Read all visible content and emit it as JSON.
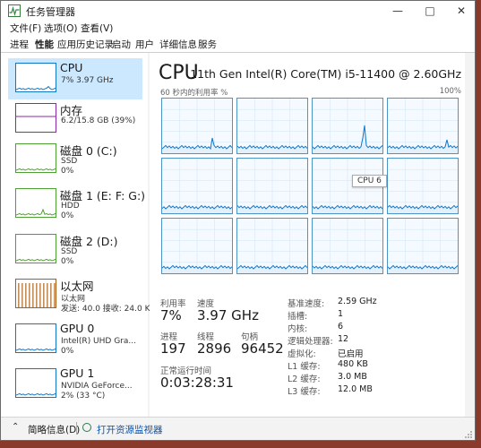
{
  "window": {
    "title": "任务管理器"
  },
  "menu": [
    "文件(F)",
    "选项(O)",
    "查看(V)"
  ],
  "tabs": [
    "进程",
    "性能",
    "应用历史记录",
    "启动",
    "用户",
    "详细信息",
    "服务"
  ],
  "active_tab": "性能",
  "sidebar": {
    "items": [
      {
        "name": "CPU",
        "sub1": "7%  3.97 GHz",
        "sub2": "",
        "color": "#1176c8"
      },
      {
        "name": "内存",
        "sub1": "6.2/15.8 GB (39%)",
        "sub2": "",
        "color": "#8b28a8"
      },
      {
        "name": "磁盘 0 (C:)",
        "sub1": "SSD",
        "sub2": "0%",
        "color": "#4da032"
      },
      {
        "name": "磁盘 1 (E: F: G:)",
        "sub1": "HDD",
        "sub2": "0%",
        "color": "#4da032"
      },
      {
        "name": "磁盘 2 (D:)",
        "sub1": "SSD",
        "sub2": "0%",
        "color": "#4da032"
      },
      {
        "name": "以太网",
        "sub1": "以太网",
        "sub2": "发送: 40.0  接收: 24.0 K",
        "color": "#a75d14"
      },
      {
        "name": "GPU 0",
        "sub1": "Intel(R) UHD Gra...",
        "sub2": "0%",
        "color": "#1176c8"
      },
      {
        "name": "GPU 1",
        "sub1": "NVIDIA GeForce...",
        "sub2": "2% (33 °C)",
        "color": "#1176c8"
      }
    ]
  },
  "main": {
    "title": "CPU",
    "model": "11th Gen Intel(R) Core(TM) i5-11400 @ 2.60GHz",
    "graph_caption": "60 秒内的利用率 %",
    "graph_max": "100%",
    "tooltip": "CPU 6",
    "stats": {
      "util_label": "利用率",
      "util_value": "7%",
      "speed_label": "速度",
      "speed_value": "3.97 GHz",
      "proc_label": "进程",
      "proc_value": "197",
      "thread_label": "线程",
      "thread_value": "2896",
      "handle_label": "句柄",
      "handle_value": "96452",
      "uptime_label": "正常运行时间",
      "uptime_value": "0:03:28:31"
    },
    "specs": [
      {
        "label": "基准速度:",
        "value": "2.59 GHz"
      },
      {
        "label": "插槽:",
        "value": "1"
      },
      {
        "label": "内核:",
        "value": "6"
      },
      {
        "label": "逻辑处理器:",
        "value": "12"
      },
      {
        "label": "虚拟化:",
        "value": "已启用"
      },
      {
        "label": "L1 缓存:",
        "value": "480 KB"
      },
      {
        "label": "L2 缓存:",
        "value": "3.0 MB"
      },
      {
        "label": "L3 缓存:",
        "value": "12.0 MB"
      }
    ]
  },
  "footer": {
    "fewer_details": "简略信息(D)",
    "open_monitor": "打开资源监视器"
  },
  "colors": {
    "cpu_line": "#1176c8",
    "selected_bg": "#cce8ff",
    "link": "#0a55b3"
  }
}
